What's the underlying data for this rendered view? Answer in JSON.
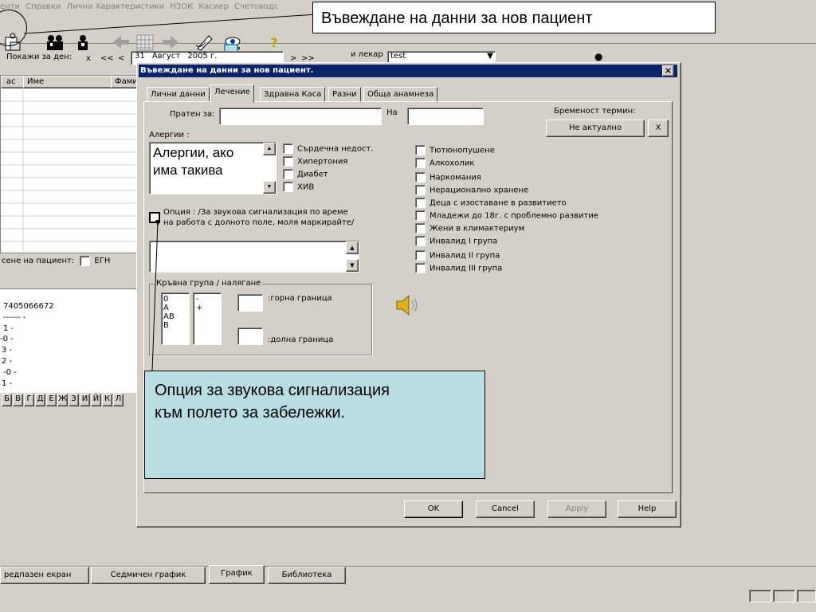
{
  "menu": [
    "енти",
    "Справки",
    "Лични Характеристики",
    "НЗОК",
    "Касиер",
    "Счетоводс"
  ],
  "toolbar_hint": "Въвеждане на данни за нов пациент",
  "date_bar": {
    "show_label": "Покажи за ден:",
    "x_btn": "x",
    "prev2": "<<",
    "prev1": "<",
    "day": "31",
    "month": "Август",
    "year": "2005 г.",
    "next1": ">",
    "next2": ">>",
    "doctor_label": "и лекар",
    "doctor_value": "test"
  },
  "left_table": {
    "col_hour": "ас",
    "col_name": "Име",
    "col_family": "Фами"
  },
  "left_search_label": "сене на пациент:",
  "egn_label": "ЕГН",
  "left_info": [
    "7405066672",
    "------  -",
    "1  -",
    "-0  -",
    "3  -",
    "2  -",
    "-0  -",
    "1  -"
  ],
  "alphabet": [
    "Б",
    "В",
    "Г",
    "Д",
    "Е",
    "Ж",
    "З",
    "И",
    "Й",
    "К",
    "Л"
  ],
  "dialog": {
    "title": "Въвеждане на данни за нов пациент.",
    "close": "×",
    "tabs": [
      "Лични данни",
      "Лечение",
      "Здравна Каса",
      "Разни",
      "Обща анамнеза"
    ],
    "sent_to_label": "Пратен за:",
    "to_label": "На",
    "pregnancy_label": "Бременост термин:",
    "pregnancy_value": "Не актуално",
    "pregnancy_clear": "X",
    "allergies_label": "Алергии :",
    "allergies_line1": "Алергии, ако",
    "allergies_line2": "има такива",
    "conditions_a": [
      "Сърдечна недост.",
      "Хипертония",
      "Диабет",
      "ХИВ"
    ],
    "conditions_b": [
      "Тютюнопушене",
      "Алкохолик",
      "Наркомания",
      "Нерационално хранене",
      "Деца с изоставане в развитието",
      "Младежи до 18г. с проблемно развитие",
      "Жени в климактериум",
      "Инвалид I група",
      "Инвалид II група",
      "Инвалид III група"
    ],
    "option_line1": "Опция : /За звукова сигнализация по време",
    "option_line2": "на работа с долното поле, моля маркирайте/",
    "blood_group_label": "Кръвна група / налягане",
    "blood_groups": [
      "0",
      "А",
      "АВ",
      "В"
    ],
    "rh": [
      "-",
      "+"
    ],
    "upper_label": ":горна граница",
    "lower_label": ":долна граница",
    "ok": "OK",
    "cancel": "Cancel",
    "apply": "Apply",
    "help": "Help"
  },
  "callout_top": "Въвеждане на данни за нов пациент",
  "callout_main_line1": "Опция за звукова сигнализация",
  "callout_main_line2": "към полето за забележки.",
  "bottom_tabs": [
    "редпазен екран",
    "Седмичен график",
    "График",
    "Библиотека"
  ],
  "colors": {
    "dialog_title_bg": "#0a246a",
    "callout_bg": "#b8dde3",
    "window_bg": "#d4d0c8"
  }
}
